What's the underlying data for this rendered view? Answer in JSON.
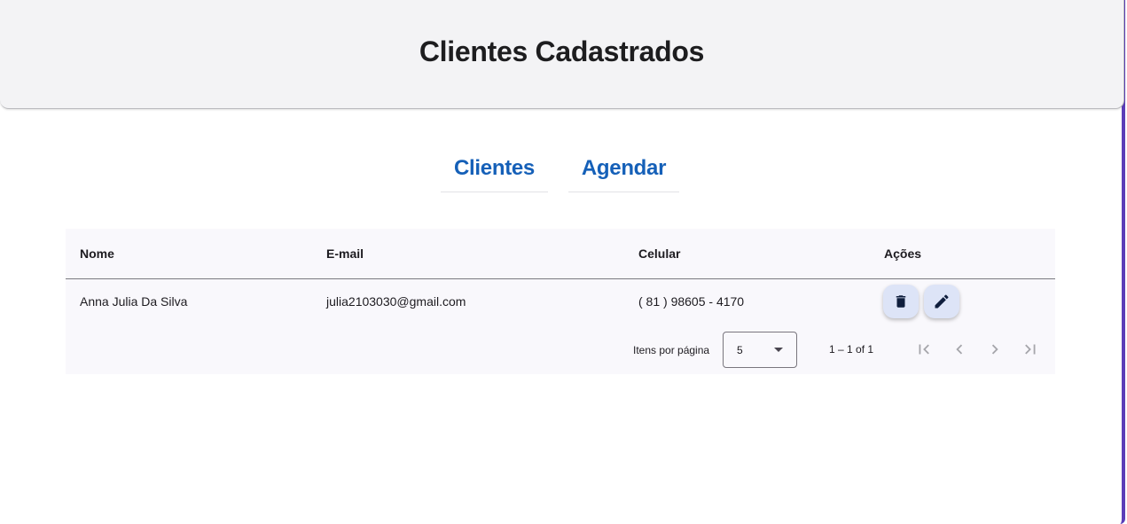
{
  "header": {
    "title": "Clientes Cadastrados"
  },
  "nav": {
    "tabs": [
      {
        "label": "Clientes"
      },
      {
        "label": "Agendar"
      }
    ]
  },
  "table": {
    "columns": [
      "Nome",
      "E-mail",
      "Celular",
      "Ações"
    ],
    "rows": [
      {
        "nome": "Anna Julia Da Silva",
        "email": "julia2103030@gmail.com",
        "celular": "( 81 ) 98605 - 4170",
        "actions": [
          "delete-icon",
          "edit-icon"
        ]
      }
    ]
  },
  "paginator": {
    "items_per_page_label": "Itens por página",
    "page_size": "5",
    "range_label": "1 – 1 of 1",
    "buttons": [
      "first-page-icon",
      "previous-page-icon",
      "next-page-icon",
      "last-page-icon"
    ]
  },
  "colors": {
    "accent": "#1560b8",
    "header_bg": "#f3f3f5",
    "table_bg": "#f9f8fc",
    "action_btn_bg": "#dde4f7",
    "window_border": "#5b3db8"
  }
}
